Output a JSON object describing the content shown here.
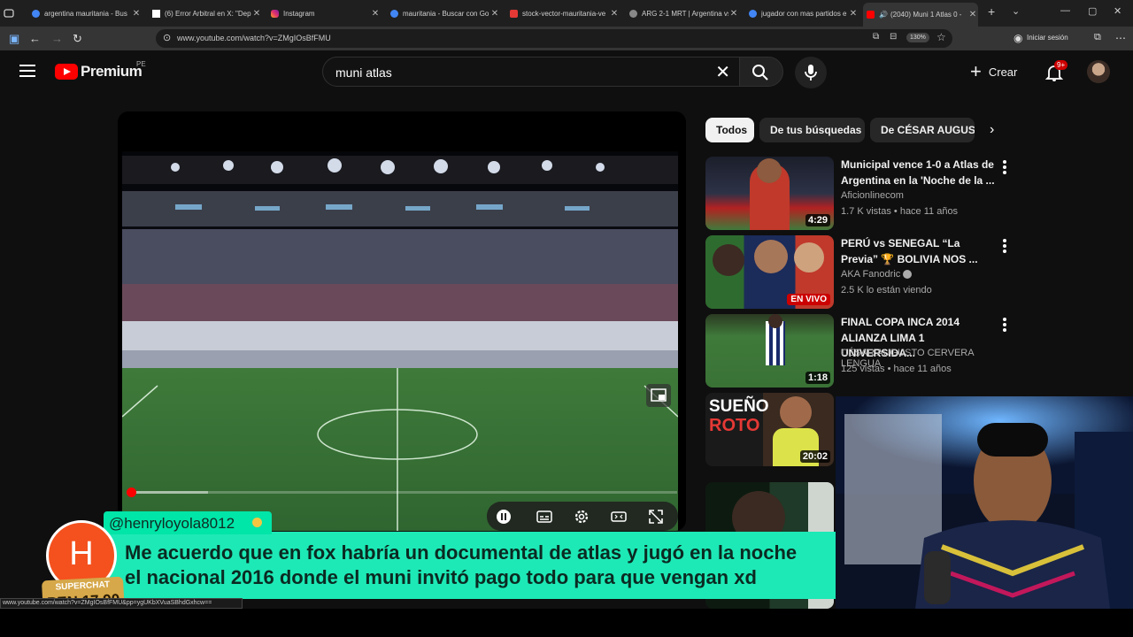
{
  "browser": {
    "tabs": [
      {
        "title": "argentina mauritania - Bus",
        "color": "#4285f4"
      },
      {
        "title": "(6) Error Arbitral en X: \"Dep",
        "color": "#ffffff"
      },
      {
        "title": "Instagram",
        "color": "#e1306c"
      },
      {
        "title": "mauritania - Buscar con Go",
        "color": "#4285f4"
      },
      {
        "title": "stock-vector-mauritania-ve",
        "color": "#e53935"
      },
      {
        "title": "ARG 2-1 MRT | Argentina vs",
        "color": "#888888"
      },
      {
        "title": "jugador con mas partidos e",
        "color": "#4285f4"
      },
      {
        "title": "(2040) Muni 1 Atlas 0 -",
        "color": "#ff0000"
      }
    ],
    "url": "www.youtube.com/watch?v=ZMgIOsBfFMU",
    "zoom": "130%",
    "signin": "Iniciar sesión"
  },
  "youtube": {
    "logo_word": "Premium",
    "country": "PE",
    "search_value": "muni atlas",
    "create_label": "Crear",
    "notif_badge": "9+",
    "chips": [
      "Todos",
      "De tus búsquedas",
      "De CÉSAR AUGUSTO"
    ],
    "related": [
      {
        "title": "Municipal vence 1-0 a Atlas de Argentina en la 'Noche de la ...",
        "channel": "Aficionlinecom",
        "meta": "1.7 K vistas • hace 11 años",
        "duration": "4:29"
      },
      {
        "title": "PERÚ vs SENEGAL “La Previa” 🏆 BOLIVIA NOS ...",
        "channel": "AKA Fanodric",
        "meta": "2.5 K lo están viendo",
        "badge": "EN VIVO"
      },
      {
        "title": "FINAL COPA INCA 2014 ALIANZA LIMA 1 UNIVERSIDA...",
        "channel": "CÉSAR AUGUSTO CERVERA LENGUA",
        "meta": "125 vistas • hace 11 años",
        "duration": "1:18"
      },
      {
        "thumb_text1": "SUEÑO",
        "thumb_text2": "ROTO",
        "duration": "20:02"
      }
    ]
  },
  "superchat": {
    "user": "@henryloyola8012",
    "avatar_letter": "H",
    "line1": "Me acuerdo que en fox habría un documental de atlas y jugó en la noche",
    "line2": "el nacional 2016 donde el muni invitó pago todo para que vengan xd",
    "tag_label": "SUPERCHAT",
    "tag_amount": "PEN 17.90"
  },
  "status_url": "www.youtube.com/watch?v=ZMgIOsBfFMU&pp=ygUKbXVuaSBhdGxhcw=="
}
